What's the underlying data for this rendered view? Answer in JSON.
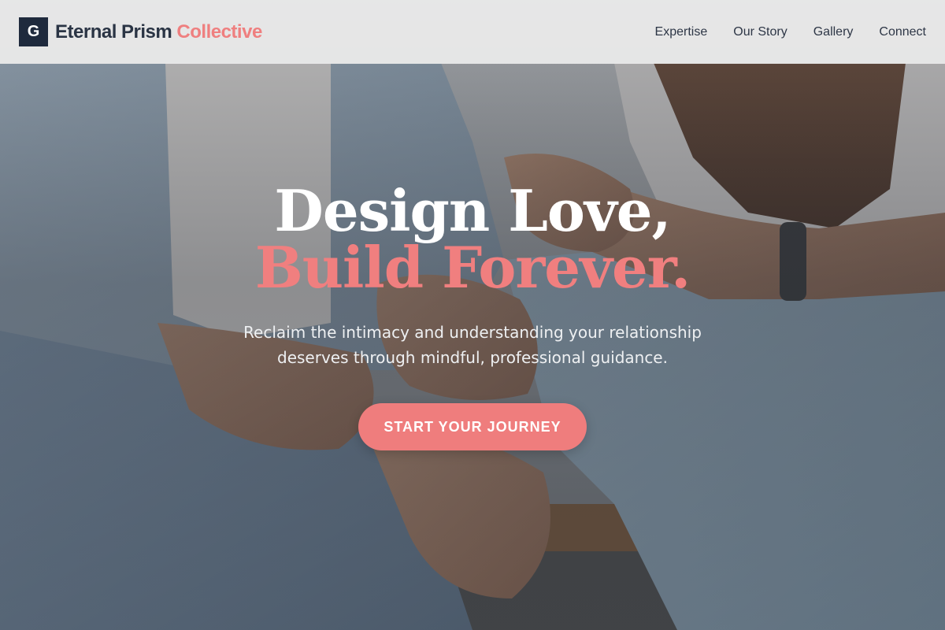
{
  "brand": {
    "mark_letter": "G",
    "name_primary": "Eternal Prism",
    "name_accent": "Collective"
  },
  "nav": {
    "items": [
      {
        "label": "Expertise"
      },
      {
        "label": "Our Story"
      },
      {
        "label": "Gallery"
      },
      {
        "label": "Connect"
      }
    ]
  },
  "hero": {
    "headline_line1": "Design Love,",
    "headline_line2": "Build Forever.",
    "subtext": "Reclaim the intimacy and understanding your relationship deserves through mindful, professional guidance.",
    "cta_label": "START YOUR JOURNEY"
  },
  "colors": {
    "brand_dark": "#1f2a3d",
    "accent_coral": "#ef7f7f",
    "header_bg": "#ececec",
    "text_light": "#ffffff"
  },
  "icons": {
    "background": "couple-holding-hands-photo"
  }
}
